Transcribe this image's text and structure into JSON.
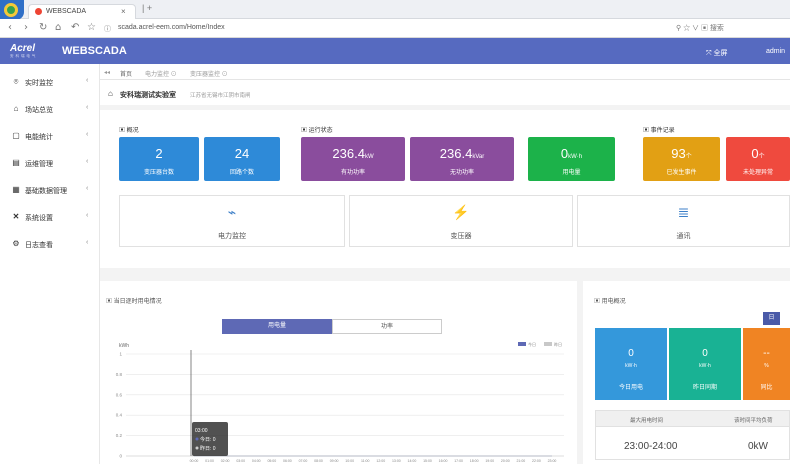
{
  "browser": {
    "tab_title": "WEBSCADA",
    "tab_close": "×",
    "new_tab": "|  +",
    "url": "scada.acrel-eem.com/Home/Index",
    "right_icons": "⚲ ☆ ∨ ▣ 搜索"
  },
  "header": {
    "logo": "Acrel",
    "logo_sub": "安 科 瑞 电 气",
    "app_name": "WEBSCADA",
    "fullscreen": "全屏",
    "user": "admin"
  },
  "sidebar": {
    "items": [
      {
        "icon": "⌾",
        "label": "实时监控",
        "arrow": "‹"
      },
      {
        "icon": "⌂",
        "label": "场站总览",
        "arrow": "‹"
      },
      {
        "icon": "▢",
        "label": "电能统计",
        "arrow": "‹"
      },
      {
        "icon": "▤",
        "label": "运维管理",
        "arrow": "‹"
      },
      {
        "icon": "▦",
        "label": "基础数据管理",
        "arrow": "‹"
      },
      {
        "icon": "✕",
        "label": "系统设置",
        "arrow": "‹"
      },
      {
        "icon": "⚙",
        "label": "日志查看",
        "arrow": "‹"
      }
    ]
  },
  "breadcrumb": {
    "back": "◂◂",
    "items": [
      "首页",
      "电力监控 ⊙",
      "变压器监控 ⊙"
    ]
  },
  "site": {
    "name": "安科瑞测试实验室",
    "address": "江苏省无锡市江阴市南闸"
  },
  "overview": {
    "title": "概况",
    "cards": [
      {
        "value": "2",
        "unit": "",
        "label": "变压器台数"
      },
      {
        "value": "24",
        "unit": "",
        "label": "回路个数"
      }
    ]
  },
  "run_status": {
    "title": "运行状态",
    "cards": [
      {
        "value": "236.4",
        "unit": "kW",
        "label": "有功功率"
      },
      {
        "value": "236.4",
        "unit": "kVar",
        "label": "无功功率"
      },
      {
        "value": "0",
        "unit": "kW·h",
        "label": "用电量"
      }
    ]
  },
  "events": {
    "title": "事件记录",
    "cards": [
      {
        "value": "93",
        "unit": "个",
        "label": "已发生事件"
      },
      {
        "value": "0",
        "unit": "个",
        "label": "未处理异常"
      }
    ]
  },
  "shortcuts": [
    {
      "icon": "⌁",
      "label": "电力监控"
    },
    {
      "icon": "⚡",
      "label": "变压器"
    },
    {
      "icon": "≣",
      "label": "通讯"
    }
  ],
  "load_panel": {
    "title": "当日逐时用电情况",
    "toggle": [
      "用电量",
      "功率"
    ],
    "legend": [
      "今日",
      "昨日"
    ]
  },
  "use_panel": {
    "title": "用电概况",
    "period_button": "日",
    "stats": [
      {
        "value": "0",
        "unit": "kW·h",
        "label": "今日用电"
      },
      {
        "value": "0",
        "unit": "kW·h",
        "label": "昨日同期"
      },
      {
        "value": "--",
        "unit": "%",
        "label": "同比"
      }
    ],
    "max_time_label": "最大用电时间",
    "avg_label": "该时间平均负荷",
    "max_time_value": "23:00-24:00",
    "avg_value": "0kW"
  },
  "chart_data": {
    "type": "line",
    "title": "",
    "xlabel": "",
    "ylabel": "kWh",
    "ylim": [
      0,
      1
    ],
    "yticks": [
      "1",
      "0.8",
      "0.6",
      "0.4",
      "0.2",
      "0"
    ],
    "categories": [
      "00:00",
      "01:00",
      "02:00",
      "03:00",
      "04:00",
      "05:00",
      "06:00",
      "07:00",
      "08:00",
      "09:00",
      "10:00",
      "11:00",
      "12:00",
      "13:00",
      "14:00",
      "15:00",
      "16:00",
      "17:00",
      "18:00",
      "19:00",
      "20:00",
      "21:00",
      "22:00",
      "23:00"
    ],
    "series": [
      {
        "name": "今日",
        "values": [
          0,
          0,
          0,
          0,
          0,
          0,
          0,
          0,
          0,
          0,
          0,
          0,
          0,
          0,
          0,
          0,
          0,
          0,
          0,
          0,
          0,
          0,
          0,
          0
        ]
      },
      {
        "name": "昨日",
        "values": [
          0,
          0,
          0,
          0,
          0,
          0,
          0,
          0,
          0,
          0,
          0,
          0,
          0,
          0,
          0,
          0,
          0,
          0,
          0,
          0,
          0,
          0,
          0,
          0
        ]
      }
    ],
    "tooltip": {
      "time": "03:00",
      "lines": [
        "今日: 0",
        "昨日: 0"
      ]
    },
    "legend_position": "top-right",
    "grid": true
  },
  "colors": {
    "header": "#566ac0",
    "blue": "#2e8ad8",
    "purple": "#8a4d9d",
    "green": "#1cb24a",
    "orange": "#e2a014",
    "red": "#ef4a3e",
    "stat_blue": "#3498db",
    "stat_green": "#19b294",
    "stat_orange": "#f08423",
    "toggle_active": "#5e69b5"
  }
}
